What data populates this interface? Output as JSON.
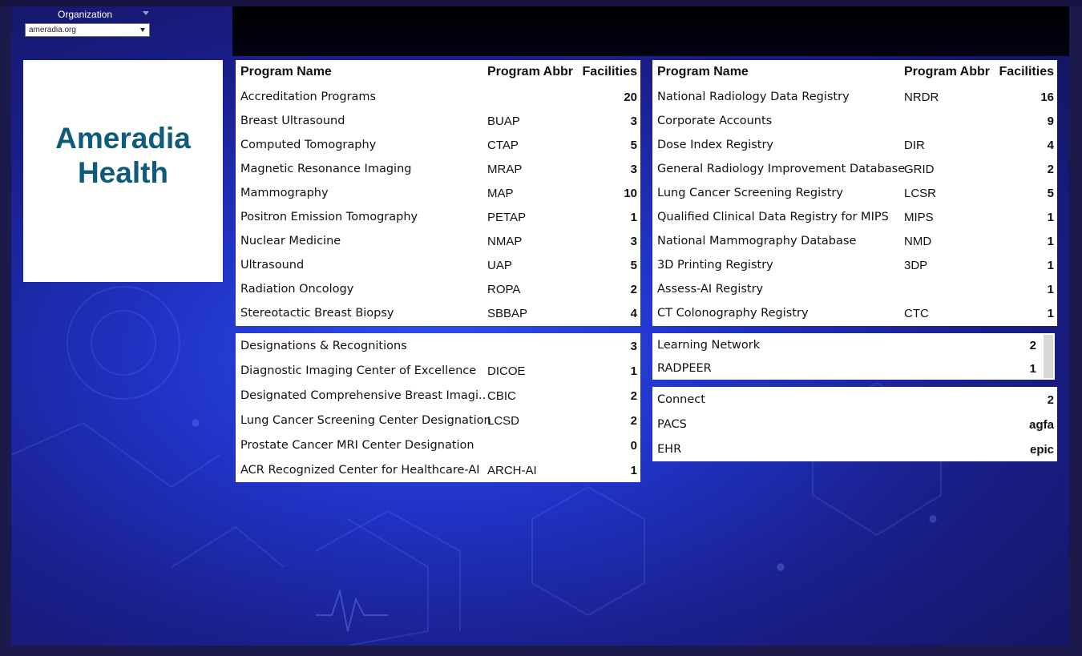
{
  "filter": {
    "title": "Organization",
    "value": "ameradia.org"
  },
  "logo": {
    "line1": "Ameradia",
    "line2": "Health"
  },
  "headers": {
    "program_name": "Program Name",
    "program_abbr": "Program Abbr",
    "facilities": "Facilities"
  },
  "accreditation_table": {
    "rows": [
      {
        "name": "Accreditation Programs",
        "abbr": "",
        "facilities": "20"
      },
      {
        "name": "Breast Ultrasound",
        "abbr": "BUAP",
        "facilities": "3"
      },
      {
        "name": "Computed Tomography",
        "abbr": "CTAP",
        "facilities": "5"
      },
      {
        "name": "Magnetic Resonance Imaging",
        "abbr": "MRAP",
        "facilities": "3"
      },
      {
        "name": "Mammography",
        "abbr": "MAP",
        "facilities": "10"
      },
      {
        "name": "Positron Emission Tomography",
        "abbr": "PETAP",
        "facilities": "1"
      },
      {
        "name": "Nuclear Medicine",
        "abbr": "NMAP",
        "facilities": "3"
      },
      {
        "name": "Ultrasound",
        "abbr": "UAP",
        "facilities": "5"
      },
      {
        "name": "Radiation Oncology",
        "abbr": "ROPA",
        "facilities": "2"
      },
      {
        "name": "Stereotactic Breast Biopsy",
        "abbr": "SBBAP",
        "facilities": "4"
      }
    ]
  },
  "registry_table": {
    "rows": [
      {
        "name": "National Radiology Data Registry",
        "abbr": "NRDR",
        "facilities": "16"
      },
      {
        "name": "Corporate Accounts",
        "abbr": "",
        "facilities": "9"
      },
      {
        "name": "Dose Index Registry",
        "abbr": "DIR",
        "facilities": "4"
      },
      {
        "name": "General Radiology Improvement Database",
        "abbr": "GRID",
        "facilities": "2"
      },
      {
        "name": "Lung Cancer Screening Registry",
        "abbr": "LCSR",
        "facilities": "5"
      },
      {
        "name": "Qualified Clinical Data Registry for MIPS",
        "abbr": "MIPS",
        "facilities": "1"
      },
      {
        "name": "National Mammography Database",
        "abbr": "NMD",
        "facilities": "1"
      },
      {
        "name": "3D Printing Registry",
        "abbr": "3DP",
        "facilities": "1"
      },
      {
        "name": "Assess-AI Registry",
        "abbr": "",
        "facilities": "1"
      },
      {
        "name": "CT Colonography Registry",
        "abbr": "CTC",
        "facilities": "1"
      }
    ]
  },
  "designations_table": {
    "rows": [
      {
        "name": "Designations & Recognitions",
        "abbr": "",
        "facilities": "3"
      },
      {
        "name": "Diagnostic Imaging Center of Excellence",
        "abbr": "DICOE",
        "facilities": "1"
      },
      {
        "name": "Designated Comprehensive Breast Imagi..",
        "abbr": "CBIC",
        "facilities": "2"
      },
      {
        "name": "Lung Cancer Screening Center Designation",
        "abbr": "LCSD",
        "facilities": "2"
      },
      {
        "name": "Prostate Cancer MRI Center Designation",
        "abbr": "",
        "facilities": "0"
      },
      {
        "name": "ACR Recognized Center for Healthcare-AI",
        "abbr": "ARCH-AI",
        "facilities": "1"
      }
    ]
  },
  "learning_table": {
    "rows": [
      {
        "name": "Learning Network",
        "facilities": "2"
      },
      {
        "name": "RADPEER",
        "facilities": "1"
      }
    ]
  },
  "connect_table": {
    "rows": [
      {
        "name": "Connect",
        "value": "2"
      },
      {
        "name": "PACS",
        "value": "agfa"
      },
      {
        "name": "EHR",
        "value": "epic"
      }
    ]
  }
}
